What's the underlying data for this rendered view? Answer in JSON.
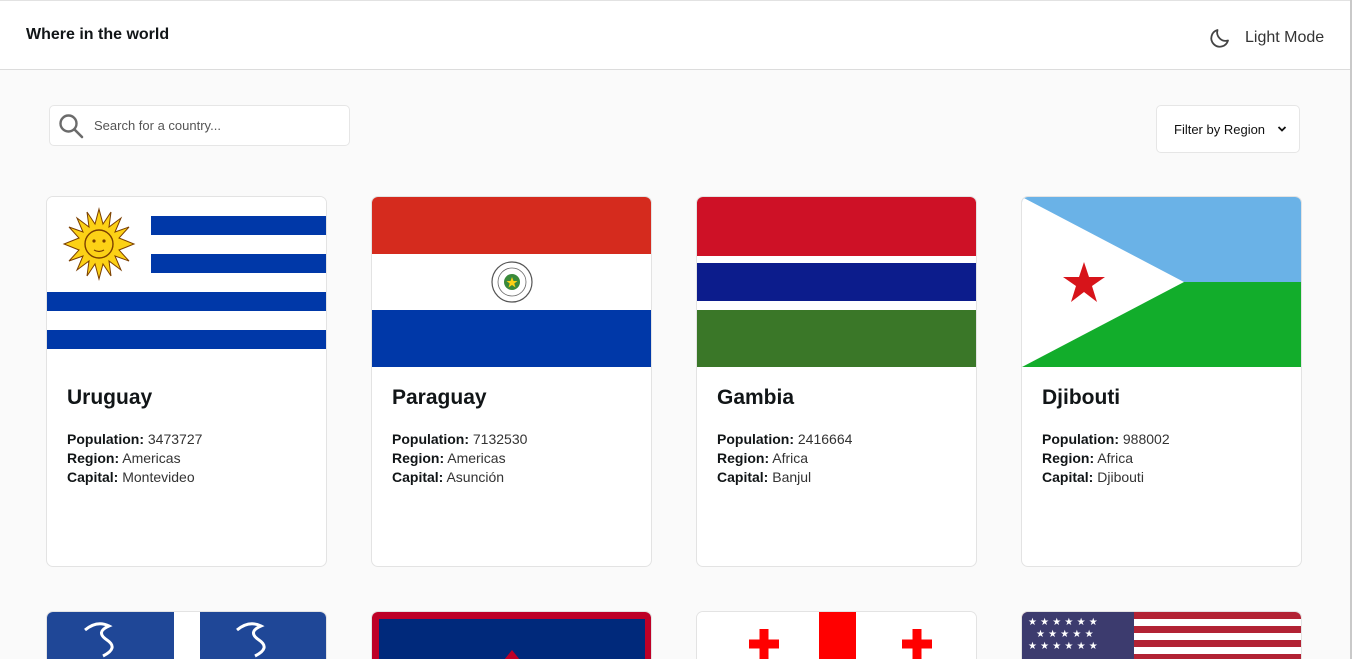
{
  "header": {
    "title": "Where in the world",
    "mode_label": "Light Mode",
    "mode_icon": "moon-icon"
  },
  "search": {
    "placeholder": "Search for a country...",
    "icon": "search-icon"
  },
  "filter": {
    "label": "Filter by Region",
    "icon": "chevron-down-icon"
  },
  "labels": {
    "population": "Population:",
    "region": "Region:",
    "capital": "Capital:"
  },
  "countries": [
    {
      "name": "Uruguay",
      "population": "3473727",
      "region": "Americas",
      "capital": "Montevideo"
    },
    {
      "name": "Paraguay",
      "population": "7132530",
      "region": "Americas",
      "capital": "Asunción"
    },
    {
      "name": "Gambia",
      "population": "2416664",
      "region": "Africa",
      "capital": "Banjul"
    },
    {
      "name": "Djibouti",
      "population": "988002",
      "region": "Africa",
      "capital": "Djibouti"
    }
  ],
  "colors": {
    "background": "#fafafa",
    "card": "#ffffff",
    "text": "#111517"
  }
}
